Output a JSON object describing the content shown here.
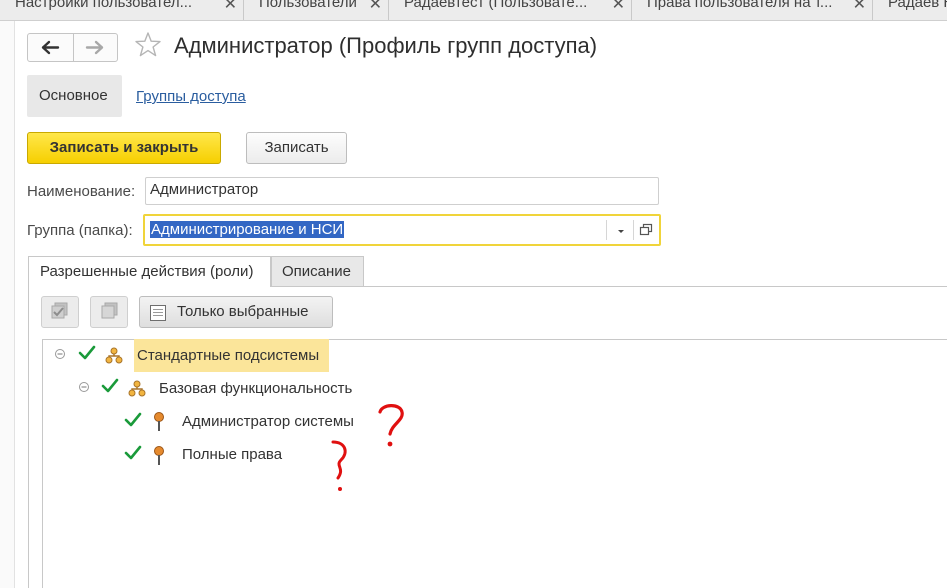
{
  "tabs": [
    {
      "label": "Настройки пользовател..."
    },
    {
      "label": "Пользователи"
    },
    {
      "label": "Радаевтест (Пользовате..."
    },
    {
      "label": "Права пользователя на т..."
    },
    {
      "label": "Радаев Н"
    }
  ],
  "header": {
    "title": "Администратор (Профиль групп доступа)"
  },
  "sections": {
    "main": "Основное",
    "groups": "Группы доступа"
  },
  "actions": {
    "save_close": "Записать и закрыть",
    "save": "Записать"
  },
  "form": {
    "name_label": "Наименование:",
    "name_value": "Администратор",
    "group_label": "Группа (папка):",
    "group_value": "Администрирование и НСИ"
  },
  "page_tabs": {
    "roles": "Разрешенные действия (роли)",
    "description": "Описание"
  },
  "toolbar": {
    "only_selected": "Только выбранные"
  },
  "tree": [
    {
      "label": "Стандартные подсистемы",
      "checked": true,
      "icon": "subsystem-icon",
      "highlighted": true
    },
    {
      "label": "Базовая функциональность",
      "checked": true,
      "icon": "subsystem-icon"
    },
    {
      "label": "Администратор системы",
      "checked": true,
      "icon": "role-pin-icon"
    },
    {
      "label": "Полные права",
      "checked": true,
      "icon": "role-pin-icon"
    }
  ],
  "colors": {
    "primary_button": "#f6cf00",
    "highlight": "#fbe59a",
    "check": "#1a9a3a",
    "link": "#2a5d9f",
    "selection": "#3367c4",
    "annotation": "#e01010"
  }
}
